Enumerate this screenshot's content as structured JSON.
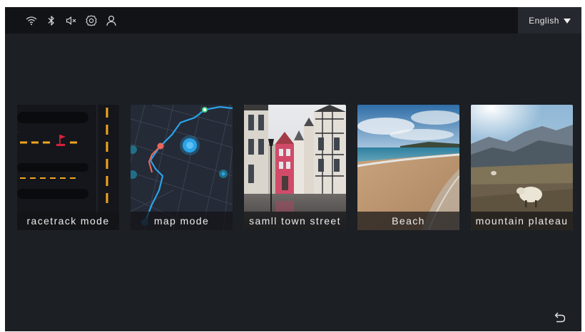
{
  "status_bar": {
    "icons": [
      "wifi-icon",
      "bluetooth-icon",
      "volume-muted-icon",
      "settings-icon",
      "user-icon"
    ]
  },
  "language": {
    "selected": "English"
  },
  "modes": [
    {
      "label": "racetrack mode"
    },
    {
      "label": "map mode"
    },
    {
      "label": "samll town street"
    },
    {
      "label": "Beach"
    },
    {
      "label": "mountain plateau"
    }
  ],
  "colors": {
    "background": "#1c1f24",
    "topbar": "#111316",
    "track_marking": "#f2a51e",
    "map_route_blue": "#2aa3e8",
    "map_route_red": "#e8665a"
  },
  "footer": {
    "icon": "back-icon"
  }
}
